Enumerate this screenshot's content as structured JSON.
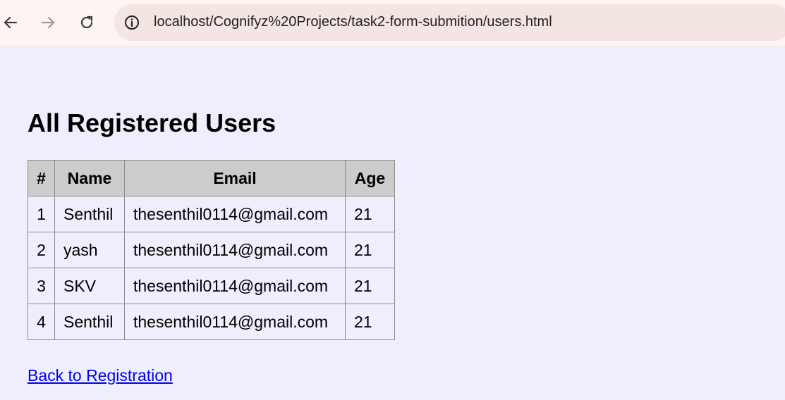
{
  "browser": {
    "url": "localhost/Cognifyz%20Projects/task2-form-submition/users.html"
  },
  "page": {
    "title": "All Registered Users",
    "back_link": "Back to Registration",
    "background_color": "#efeefd"
  },
  "table": {
    "headers": [
      "#",
      "Name",
      "Email",
      "Age"
    ],
    "rows": [
      {
        "num": "1",
        "name": "Senthil",
        "email": "thesenthil0114@gmail.com",
        "age": "21"
      },
      {
        "num": "2",
        "name": "yash",
        "email": "thesenthil0114@gmail.com",
        "age": "21"
      },
      {
        "num": "3",
        "name": "SKV",
        "email": "thesenthil0114@gmail.com",
        "age": "21"
      },
      {
        "num": "4",
        "name": "Senthil",
        "email": "thesenthil0114@gmail.com",
        "age": "21"
      }
    ],
    "header_background": "#cccccc"
  },
  "icons": {
    "back": "arrow-left-icon",
    "forward": "arrow-right-icon",
    "reload": "reload-icon",
    "site_info": "info-circle-icon"
  }
}
